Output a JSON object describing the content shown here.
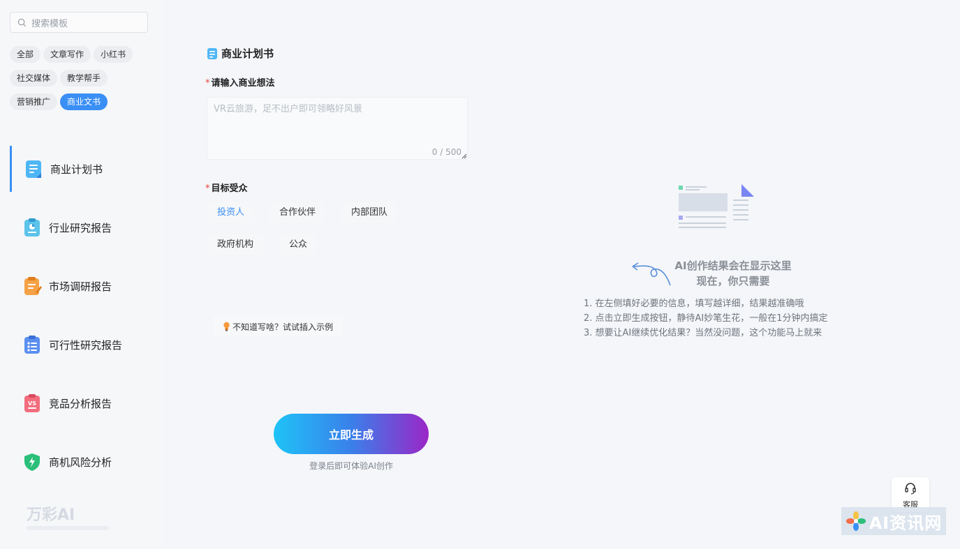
{
  "sidebar": {
    "search": {
      "placeholder": "搜索模板"
    },
    "tags": [
      {
        "label": "全部"
      },
      {
        "label": "文章写作"
      },
      {
        "label": "小红书"
      },
      {
        "label": "社交媒体"
      },
      {
        "label": "教学帮手"
      },
      {
        "label": "营销推广"
      },
      {
        "label": "商业文书",
        "active": true
      }
    ],
    "items": [
      {
        "label": "商业计划书",
        "icon": "business-plan-icon",
        "active": true
      },
      {
        "label": "行业研究报告",
        "icon": "industry-report-icon"
      },
      {
        "label": "市场调研报告",
        "icon": "market-research-icon"
      },
      {
        "label": "可行性研究报告",
        "icon": "feasibility-report-icon"
      },
      {
        "label": "竞品分析报告",
        "icon": "competitor-analysis-icon"
      },
      {
        "label": "商机风险分析",
        "icon": "risk-analysis-icon"
      }
    ],
    "logo": {
      "text": "万彩AI"
    }
  },
  "form": {
    "title": "商业计划书",
    "idea": {
      "label": "请输入商业想法",
      "placeholder": "VR云旅游，足不出户即可领略好风景",
      "counter": "0 / 500"
    },
    "audience": {
      "label": "目标受众",
      "options": [
        {
          "label": "投资人",
          "selected": true
        },
        {
          "label": "合作伙伴"
        },
        {
          "label": "内部团队"
        },
        {
          "label": "政府机构"
        },
        {
          "label": "公众"
        }
      ]
    },
    "hint": "不知道写啥？试试插入示例",
    "generate_label": "立即生成",
    "login_tip": "登录后即可体验AI创作"
  },
  "result": {
    "title_line1": "AI创作结果会在显示这里",
    "title_line2": "现在，你只需要",
    "steps": [
      "1. 在左侧填好必要的信息，填写越详细，结果越准确哦",
      "2. 点击立即生成按钮，静待AI妙笔生花，一般在1分钟内搞定",
      "3. 想要让AI继续优化结果？当然没问题，这个功能马上就来"
    ]
  },
  "service": {
    "label": "客服"
  },
  "watermark": {
    "text": "AI资讯网"
  },
  "colors": {
    "accent": "#3a8ff5",
    "required": "#e8433c"
  }
}
